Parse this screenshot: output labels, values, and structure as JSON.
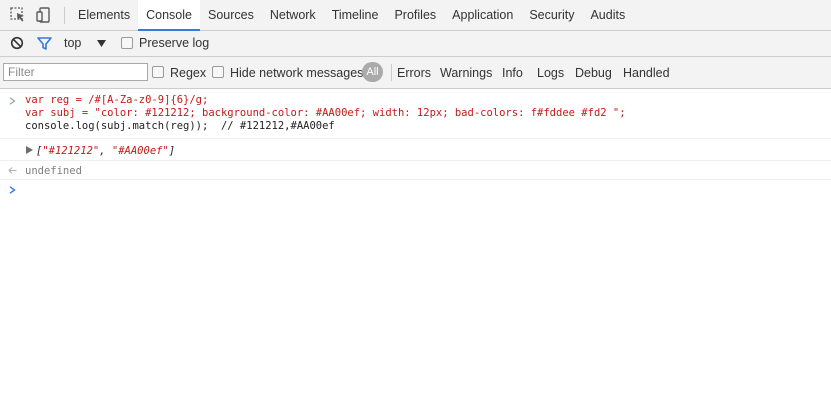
{
  "tabs": [
    {
      "label": "Elements",
      "active": false
    },
    {
      "label": "Console",
      "active": true
    },
    {
      "label": "Sources",
      "active": false
    },
    {
      "label": "Network",
      "active": false
    },
    {
      "label": "Timeline",
      "active": false
    },
    {
      "label": "Profiles",
      "active": false
    },
    {
      "label": "Application",
      "active": false
    },
    {
      "label": "Security",
      "active": false
    },
    {
      "label": "Audits",
      "active": false
    }
  ],
  "toolbar": {
    "context": "top",
    "preserve_log": "Preserve log"
  },
  "filter": {
    "placeholder": "Filter",
    "regex": "Regex",
    "hide_network": "Hide network messages",
    "all": "All",
    "levels": [
      "Errors",
      "Warnings",
      "Info",
      "Logs",
      "Debug",
      "Handled"
    ]
  },
  "console": {
    "input_lines": [
      "var reg = /#[A-Za-z0-9]{6}/g;",
      "var subj = \"color: #121212; background-color: #AA00ef; width: 12px; bad-colors: f#fddee #fd2 \";",
      "console.log(subj.match(reg));  // #121212,#AA00ef"
    ],
    "log_open": "[",
    "log_item_1": "\"#121212\"",
    "log_comma": ", ",
    "log_item_2": "\"#AA00ef\"",
    "log_close": "]",
    "result": "undefined"
  },
  "colors": {
    "accent": "#3879d9",
    "prompt": "#367cf1",
    "string": "#c41a16",
    "comment": "#236e25"
  }
}
